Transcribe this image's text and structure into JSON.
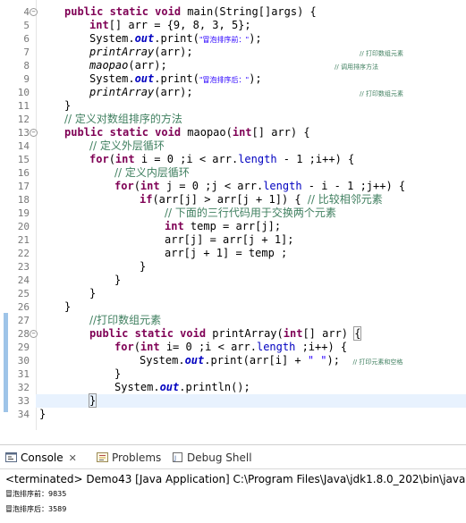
{
  "editor": {
    "lines": [
      {
        "n": "4",
        "fold": "−"
      },
      {
        "n": "5"
      },
      {
        "n": "6"
      },
      {
        "n": "7"
      },
      {
        "n": "8"
      },
      {
        "n": "9"
      },
      {
        "n": "10"
      },
      {
        "n": "11"
      },
      {
        "n": "12"
      },
      {
        "n": "13",
        "fold": "−"
      },
      {
        "n": "14"
      },
      {
        "n": "15"
      },
      {
        "n": "16"
      },
      {
        "n": "17"
      },
      {
        "n": "18"
      },
      {
        "n": "19"
      },
      {
        "n": "20"
      },
      {
        "n": "21"
      },
      {
        "n": "22"
      },
      {
        "n": "23"
      },
      {
        "n": "24"
      },
      {
        "n": "25"
      },
      {
        "n": "26"
      },
      {
        "n": "27"
      },
      {
        "n": "28",
        "fold": "−"
      },
      {
        "n": "29"
      },
      {
        "n": "30"
      },
      {
        "n": "31"
      },
      {
        "n": "32"
      },
      {
        "n": "33"
      },
      {
        "n": "34"
      }
    ],
    "code": {
      "l4_kw": "public static void ",
      "l4_rest": "main(String[]args) {",
      "l5_kw": "int",
      "l5_rest": "[] arr = {9, 8, 3, 5};",
      "l6_a": "System.",
      "l6_out": "out",
      "l6_b": ".print(",
      "l6_str": "\"冒泡排序前：\"",
      "l6_c": ");",
      "l7_m": "printArray",
      "l7_rest": "(arr);",
      "l7_cm": "// 打印数组元素",
      "l8_m": "maopao",
      "l8_rest": "(arr);",
      "l8_cm": "// 调用排序方法",
      "l9_a": "System.",
      "l9_out": "out",
      "l9_b": ".print(",
      "l9_str": "\"冒泡排序后：\"",
      "l9_c": ");",
      "l10_m": "printArray",
      "l10_rest": "(arr);",
      "l10_cm": "// 打印数组元素",
      "l11": "}",
      "l12_cm": "// 定义对数组排序的方法",
      "l13_kw": "public static void ",
      "l13_a": "maopao(",
      "l13_int": "int",
      "l13_b": "[] arr) {",
      "l14_cm": "// 定义外层循环",
      "l15_for": "for",
      "l15_a": "(",
      "l15_int": "int",
      "l15_b": " i = 0 ;i < arr.",
      "l15_len": "length",
      "l15_c": " - 1 ;i++) {",
      "l16_cm": "// 定义内层循环",
      "l17_for": "for",
      "l17_a": "(",
      "l17_int": "int",
      "l17_b": " j = 0 ;j < arr.",
      "l17_len": "length",
      "l17_c": " - i - 1 ;j++) {",
      "l18_if": "if",
      "l18_a": "(arr[j] > arr[j + 1]) { ",
      "l18_cm": "// 比较相邻元素",
      "l19_cm": "// 下面的三行代码用于交换两个元素",
      "l20_int": "int",
      "l20_rest": " temp = arr[j];",
      "l21": "arr[j] = arr[j + 1];",
      "l22": "arr[j + 1] = temp ;",
      "l23": "}",
      "l24": "}",
      "l25": "}",
      "l26": "",
      "l27_cm": "//打印数组元素",
      "l28_kw": "public static void ",
      "l28_a": "printArray(",
      "l28_int": "int",
      "l28_b": "[] arr) ",
      "l28_br": "{",
      "l29_for": "for",
      "l29_a": "(",
      "l29_int": "int",
      "l29_b": " i= 0 ;i < arr.",
      "l29_len": "length",
      "l29_c": " ;i++) {",
      "l30_a": "System.",
      "l30_out": "out",
      "l30_b": ".print(arr[i] + ",
      "l30_str": "\" \"",
      "l30_c": ");  ",
      "l30_cm": "// 打印元素和空格",
      "l31": "}",
      "l32_a": "System.",
      "l32_out": "out",
      "l32_b": ".println();",
      "l33": "}",
      "l34": "}"
    }
  },
  "console": {
    "tabs": [
      {
        "label": "Console",
        "close": "✕",
        "icon": "console-icon"
      },
      {
        "label": "Problems",
        "icon": "problems-icon"
      },
      {
        "label": "Debug Shell",
        "icon": "debug-shell-icon"
      }
    ],
    "status": "<terminated> Demo43 [Java Application] C:\\Program Files\\Java\\jdk1.8.0_202\\bin\\javaw.exe",
    "output": [
      "冒泡排序前：9835",
      "冒泡排序后：3589"
    ]
  },
  "colors": {
    "keyword": "#7f0055",
    "string": "#2a00ff",
    "comment": "#3f7f5f",
    "field": "#0000c0",
    "current_line": "#e8f2fe"
  }
}
